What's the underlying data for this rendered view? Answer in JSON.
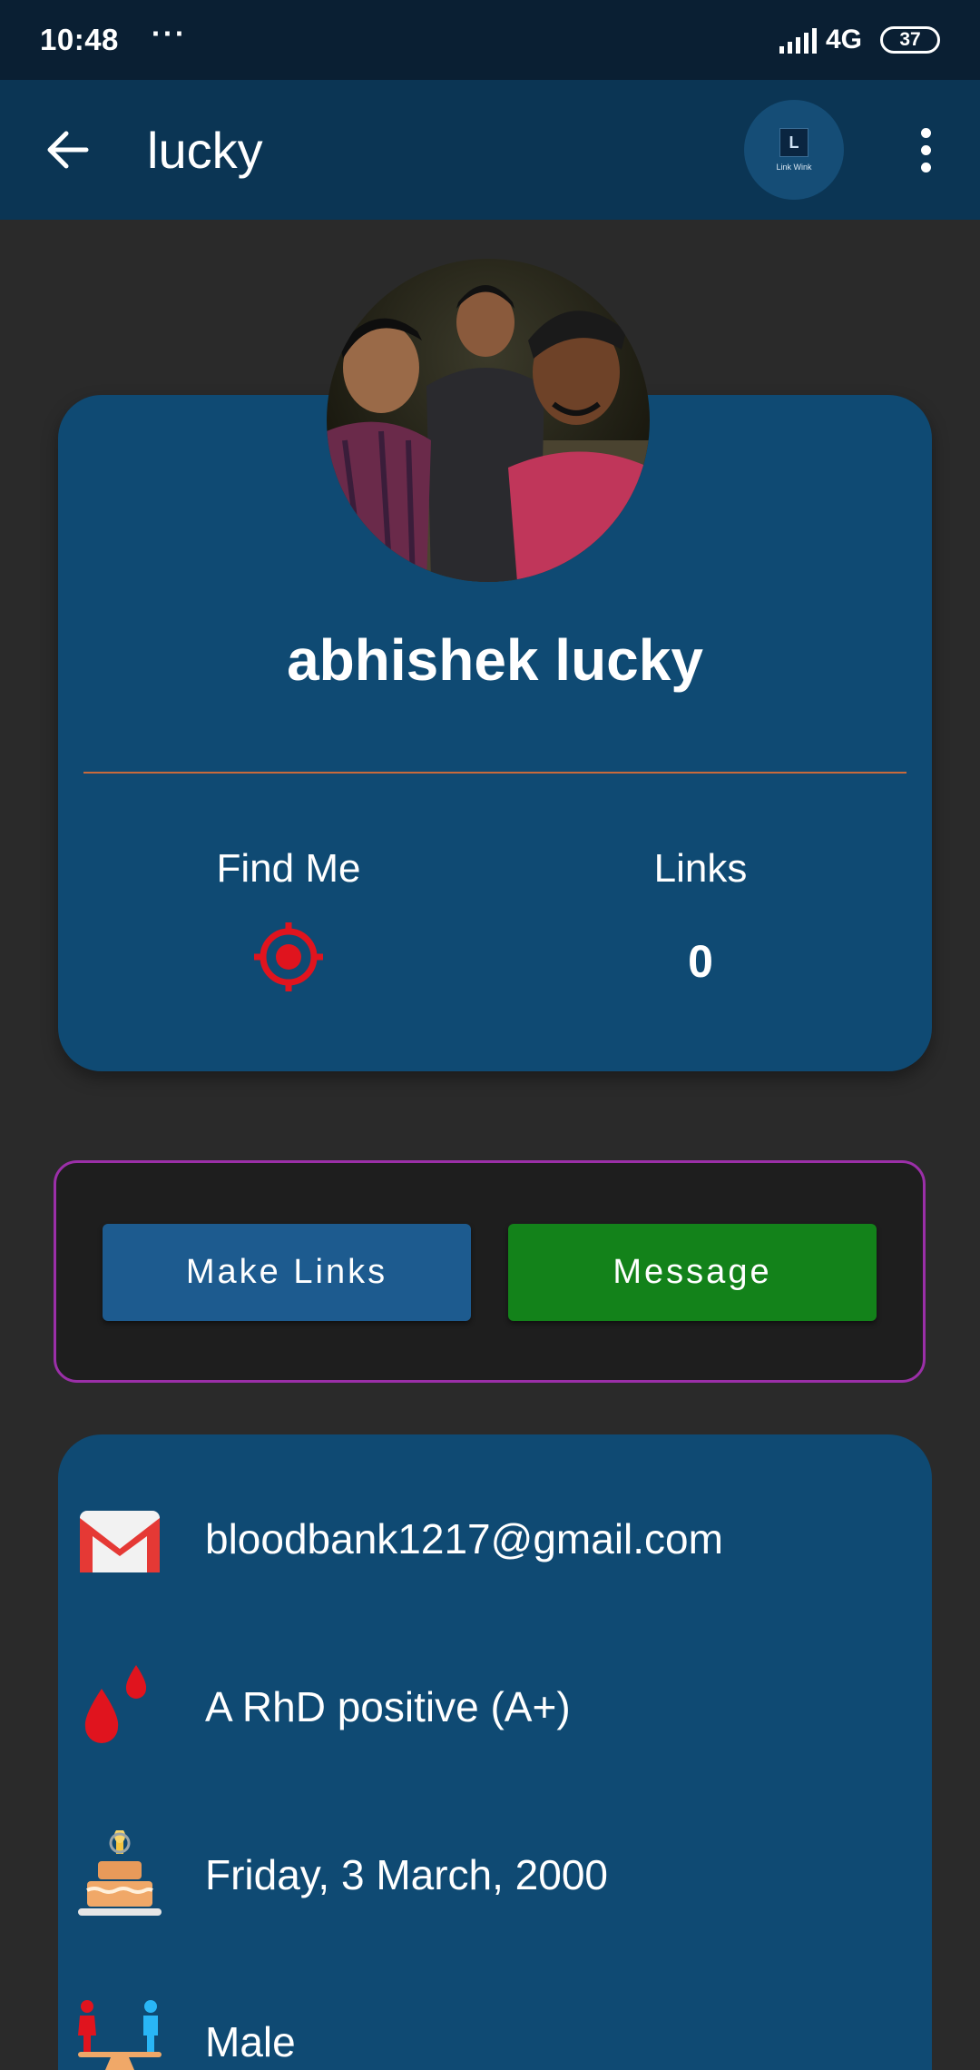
{
  "status_bar": {
    "time": "10:48",
    "dots": "···",
    "network": "4G",
    "battery": "37"
  },
  "app_bar": {
    "title": "lucky",
    "logo_letter": "L",
    "logo_caption": "Link Wink"
  },
  "profile": {
    "name": "abhishek lucky",
    "find_me_label": "Find Me",
    "links_label": "Links",
    "links_count": "0"
  },
  "actions": {
    "make_links_label": "Make Links",
    "message_label": "Message"
  },
  "info": {
    "email": "bloodbank1217@gmail.com",
    "blood_group": "A RhD positive (A+)",
    "birthday": "Friday, 3 March, 2000",
    "gender": "Male"
  },
  "colors": {
    "status_bar": "#0a1f33",
    "app_bar": "#0b3554",
    "card": "#0f4a73",
    "make_links_button": "#1d5b8f",
    "message_button": "#13821a",
    "action_border": "#9b2fa8",
    "divider": "#c86a3c"
  }
}
